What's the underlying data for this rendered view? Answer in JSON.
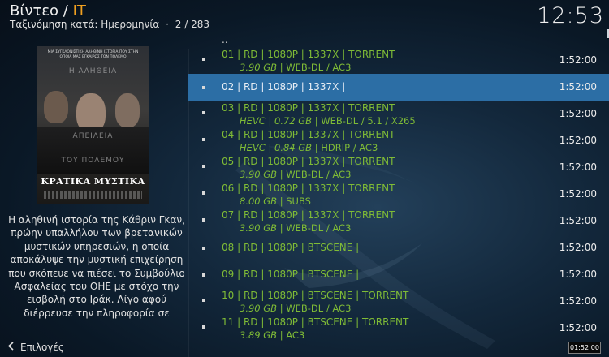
{
  "header": {
    "title_main": "Βίντεο / ",
    "title_accent": "IT",
    "sort_label": "Ταξινόμηση κατά: Ημερομηνία",
    "separator": "·",
    "position": "2 / 283"
  },
  "clock": "12:53",
  "poster": {
    "tagline": "ΜΙΑ ΣΥΓΚΛΟΝΙΣΤΙΚΗ ΑΛΗΘΙΝΗ ΙΣΤΟΡΙΑ ΠΟΥ ΣΤΗΝ ΟΠΟΙΑ ΜΑΣ ΕΓΚΑΙΡΩΣ ΤΟΝ ΠΟΛΕΜΟ",
    "overlay_1": "Η ΑΛΗΘΕΙΑ",
    "overlay_2": "ΑΠΕΙΛΕΙΑ",
    "overlay_3": "ΤΟΥ ΠΟΛΕΜΟΥ",
    "title": "ΚΡΑΤΙΚΑ ΜΥΣΤΙΚΑ"
  },
  "plot": "Η αληθινή ιστορία της Κάθριν Γκαν, πρώην υπαλλήλου των βρετανικών μυστικών υπηρεσιών, η οποία αποκάλυψε την μυστική επιχείρηση που σκόπευε να πιέσει το Συμβούλιο Ασφαλείας του ΟΗΕ με στόχο την εισβολή στο Ιράκ. Λίγο αφού διέρρευσε την πληροφορία σε",
  "options_label": "Επιλογές",
  "parent_item": "..",
  "items": [
    {
      "line1": "01 | RD | 1080P | 1337X | TORRENT",
      "codec": "",
      "size": "3.90 GB",
      "info": "WEB-DL / AC3",
      "duration": "1:52:00"
    },
    {
      "line1": "02 | RD | 1080P | 1337X |",
      "codec": "",
      "size": "",
      "info": "",
      "duration": "1:52:00"
    },
    {
      "line1": "03 | RD | 1080P | 1337X | TORRENT",
      "codec": "HEVC",
      "size": "0.72 GB",
      "info": "WEB-DL / 5.1 / X265",
      "duration": "1:52:00"
    },
    {
      "line1": "04 | RD | 1080P | 1337X | TORRENT",
      "codec": "HEVC",
      "size": "0.84 GB",
      "info": "HDRIP / AC3",
      "duration": "1:52:00"
    },
    {
      "line1": "05 | RD | 1080P | 1337X | TORRENT",
      "codec": "",
      "size": "3.90 GB",
      "info": "WEB-DL / AC3",
      "duration": "1:52:00"
    },
    {
      "line1": "06 | RD | 1080P | 1337X | TORRENT",
      "codec": "",
      "size": "8.00 GB",
      "info": "SUBS",
      "duration": "1:52:00"
    },
    {
      "line1": "07 | RD | 1080P | 1337X | TORRENT",
      "codec": "",
      "size": "3.90 GB",
      "info": "WEB-DL / AC3",
      "duration": "1:52:00"
    },
    {
      "line1": "08 | RD | 1080P | BTSCENE |",
      "codec": "",
      "size": "",
      "info": "",
      "duration": "1:52:00"
    },
    {
      "line1": "09 | RD | 1080P | BTSCENE |",
      "codec": "",
      "size": "",
      "info": "",
      "duration": "1:52:00"
    },
    {
      "line1": "10 | RD | 1080P | BTSCENE | TORRENT",
      "codec": "",
      "size": "3.90 GB",
      "info": "WEB-DL / AC3",
      "duration": "1:52:00"
    },
    {
      "line1": "11 | RD | 1080P | BTSCENE | TORRENT",
      "codec": "",
      "size": "3.89 GB",
      "info": "AC3",
      "duration": "1:52:00"
    }
  ],
  "selected_index": 1,
  "mini_clock": "01:52:00",
  "colors": {
    "accent": "#f0a020",
    "item_text": "#7fbb36",
    "selection": "#2c6ea5"
  }
}
